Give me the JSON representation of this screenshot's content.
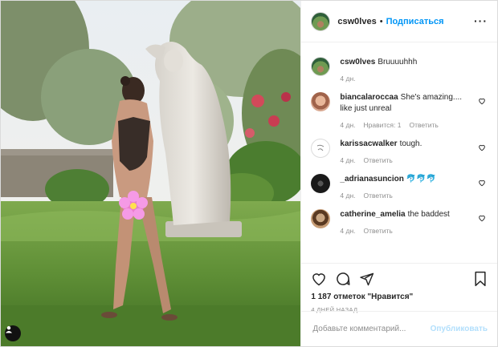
{
  "header": {
    "username": "csw0lves",
    "separator": "•",
    "follow_label": "Подписаться",
    "more_icon": "more-horizontal-icon"
  },
  "comments": [
    {
      "user": "csw0lves",
      "text": "Bruuuuhhh",
      "time": "4 дн.",
      "likes": "",
      "reply": ""
    },
    {
      "user": "biancalaroccaa",
      "text": "She's amazing.... like just unreal",
      "time": "4 дн.",
      "likes": "Нравится: 1",
      "reply": "Ответить"
    },
    {
      "user": "karissacwalker",
      "text": "tough.",
      "time": "4 дн.",
      "likes": "",
      "reply": "Ответить"
    },
    {
      "user": "_adrianasuncion",
      "text": "🐬🐬🐬",
      "time": "4 дн.",
      "likes": "",
      "reply": "Ответить"
    },
    {
      "user": "catherine_amelia",
      "text": "the baddest",
      "time": "4 дн.",
      "likes": "",
      "reply": "Ответить"
    }
  ],
  "actions": {
    "likes_text": "1 187 отметок \"Нравится\"",
    "time_ago": "4 ДНЕЙ НАЗАД"
  },
  "add_comment": {
    "placeholder": "Добавьте комментарий...",
    "publish_label": "Опубликовать"
  },
  "colors": {
    "accent": "#0095f6",
    "publish_disabled": "#b2dffc",
    "muted": "#8e8e8e"
  }
}
